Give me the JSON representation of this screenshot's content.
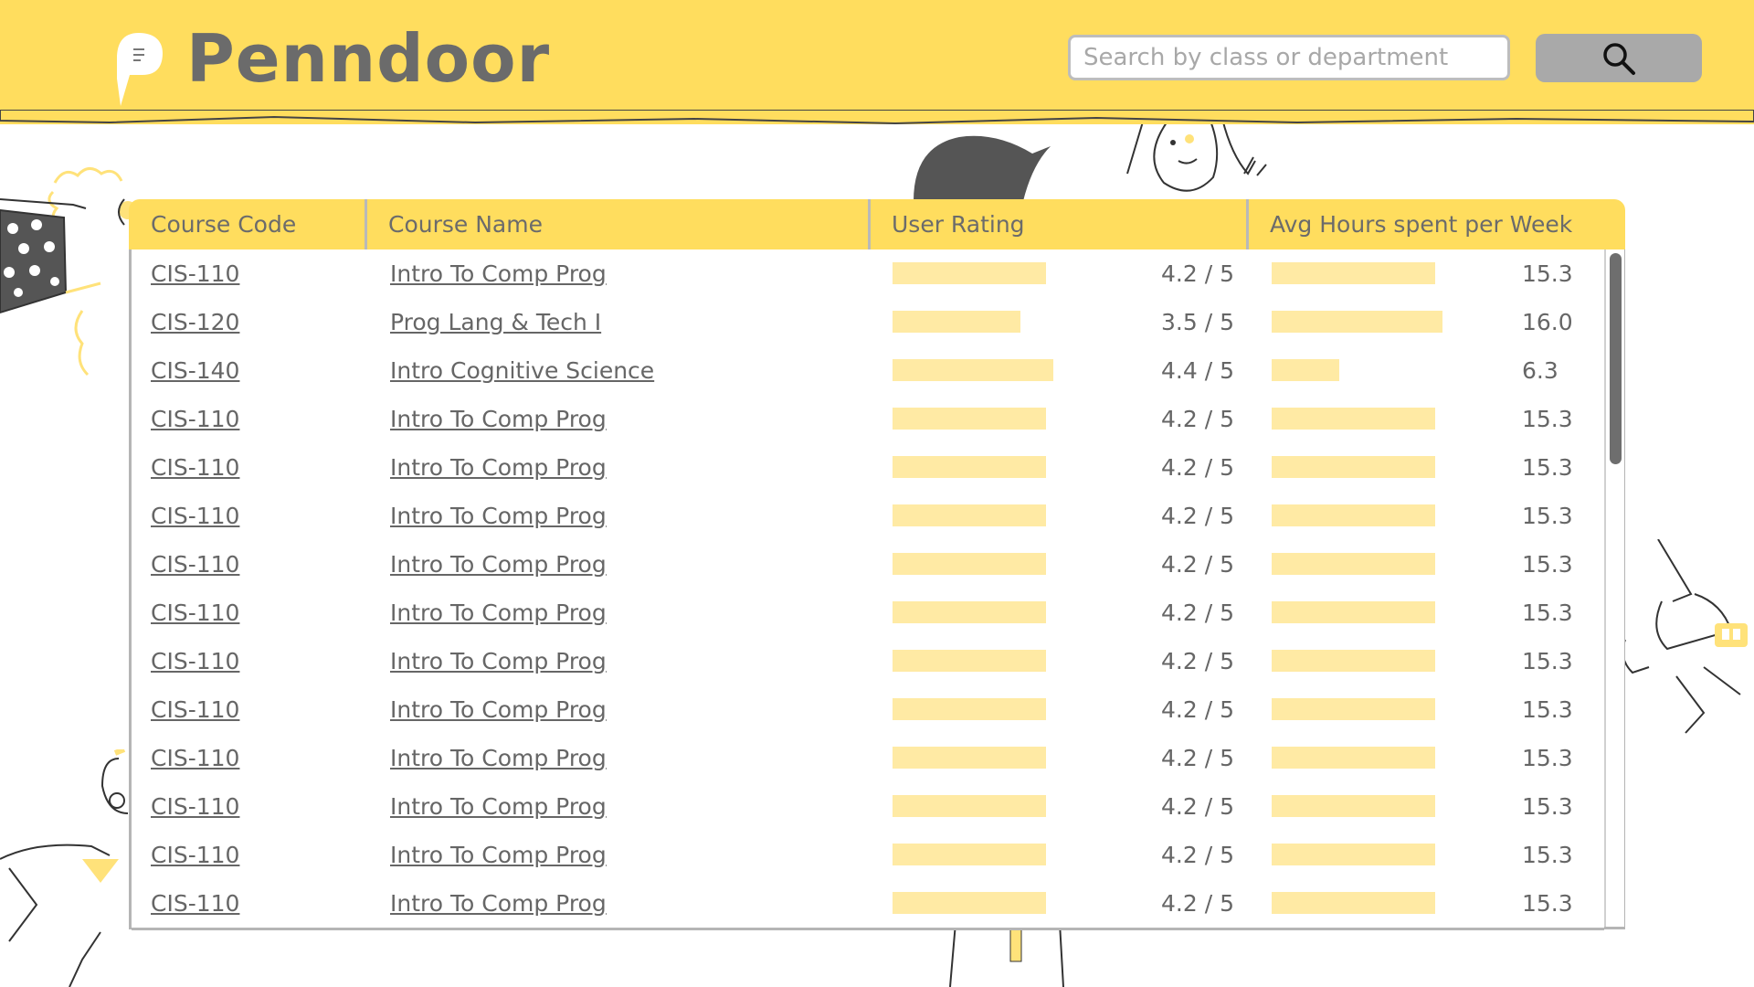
{
  "header": {
    "brand": "Penndoor",
    "search_placeholder": "Search by class or department",
    "search_icon": "search-icon"
  },
  "colors": {
    "header_bg": "#ffdd5e",
    "bar_fill": "#ffeaa4",
    "text": "#666666",
    "button_bg": "#a9a9a9"
  },
  "table": {
    "columns": [
      "Course Code",
      "Course Name",
      "User Rating",
      "Avg Hours spent per Week"
    ],
    "rating_max": 5,
    "rows": [
      {
        "code": "CIS-110",
        "name": "Intro To Comp Prog",
        "rating": 4.2,
        "rating_label": "4.2 / 5",
        "hours": 15.3,
        "hours_label": "15.3"
      },
      {
        "code": "CIS-120",
        "name": "Prog Lang & Tech I",
        "rating": 3.5,
        "rating_label": "3.5 / 5",
        "hours": 16.0,
        "hours_label": "16.0"
      },
      {
        "code": "CIS-140",
        "name": "Intro Cognitive Science",
        "rating": 4.4,
        "rating_label": "4.4 / 5",
        "hours": 6.3,
        "hours_label": "6.3"
      },
      {
        "code": "CIS-110",
        "name": "Intro To Comp Prog",
        "rating": 4.2,
        "rating_label": "4.2 / 5",
        "hours": 15.3,
        "hours_label": "15.3"
      },
      {
        "code": "CIS-110",
        "name": "Intro To Comp Prog",
        "rating": 4.2,
        "rating_label": "4.2 / 5",
        "hours": 15.3,
        "hours_label": "15.3"
      },
      {
        "code": "CIS-110",
        "name": "Intro To Comp Prog",
        "rating": 4.2,
        "rating_label": "4.2 / 5",
        "hours": 15.3,
        "hours_label": "15.3"
      },
      {
        "code": "CIS-110",
        "name": "Intro To Comp Prog",
        "rating": 4.2,
        "rating_label": "4.2 / 5",
        "hours": 15.3,
        "hours_label": "15.3"
      },
      {
        "code": "CIS-110",
        "name": "Intro To Comp Prog",
        "rating": 4.2,
        "rating_label": "4.2 / 5",
        "hours": 15.3,
        "hours_label": "15.3"
      },
      {
        "code": "CIS-110",
        "name": "Intro To Comp Prog",
        "rating": 4.2,
        "rating_label": "4.2 / 5",
        "hours": 15.3,
        "hours_label": "15.3"
      },
      {
        "code": "CIS-110",
        "name": "Intro To Comp Prog",
        "rating": 4.2,
        "rating_label": "4.2 / 5",
        "hours": 15.3,
        "hours_label": "15.3"
      },
      {
        "code": "CIS-110",
        "name": "Intro To Comp Prog",
        "rating": 4.2,
        "rating_label": "4.2 / 5",
        "hours": 15.3,
        "hours_label": "15.3"
      },
      {
        "code": "CIS-110",
        "name": "Intro To Comp Prog",
        "rating": 4.2,
        "rating_label": "4.2 / 5",
        "hours": 15.3,
        "hours_label": "15.3"
      },
      {
        "code": "CIS-110",
        "name": "Intro To Comp Prog",
        "rating": 4.2,
        "rating_label": "4.2 / 5",
        "hours": 15.3,
        "hours_label": "15.3"
      },
      {
        "code": "CIS-110",
        "name": "Intro To Comp Prog",
        "rating": 4.2,
        "rating_label": "4.2 / 5",
        "hours": 15.3,
        "hours_label": "15.3"
      }
    ]
  }
}
